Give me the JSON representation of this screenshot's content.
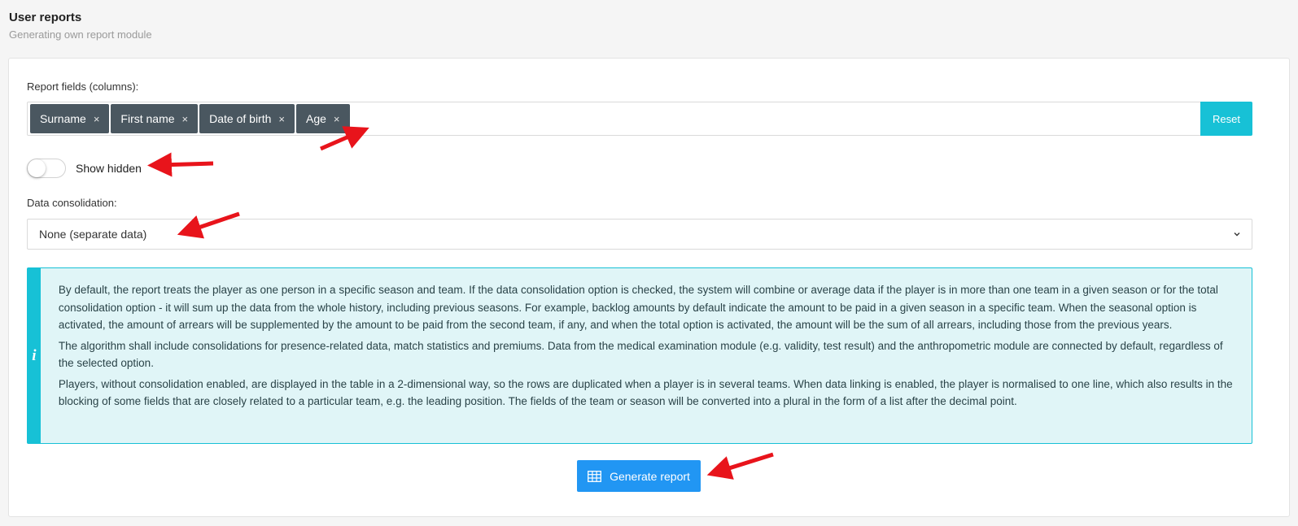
{
  "header": {
    "title": "User reports",
    "subtitle": "Generating own report module"
  },
  "report_fields": {
    "label": "Report fields (columns):",
    "tags": [
      {
        "label": "Surname",
        "remove": "×"
      },
      {
        "label": "First name",
        "remove": "×"
      },
      {
        "label": "Date of birth",
        "remove": "×"
      },
      {
        "label": "Age",
        "remove": "×"
      }
    ],
    "reset_label": "Reset"
  },
  "show_hidden": {
    "label": "Show hidden",
    "checked": false
  },
  "consolidation": {
    "label": "Data consolidation:",
    "selected": "None (separate data)"
  },
  "info": {
    "icon_glyph": "i",
    "paragraphs": [
      "By default, the report treats the player as one person in a specific season and team. If the data consolidation option is checked, the system will combine or average data if the player is in more than one team in a given season or for the total consolidation option - it will sum up the data from the whole history, including previous seasons. For example, backlog amounts by default indicate the amount to be paid in a given season in a specific team. When the seasonal option is activated, the amount of arrears will be supplemented by the amount to be paid from the second team, if any, and when the total option is activated, the amount will be the sum of all arrears, including those from the previous years.",
      "The algorithm shall include consolidations for presence-related data, match statistics and premiums. Data from the medical examination module (e.g. validity, test result) and the anthropometric module are connected by default, regardless of the selected option.",
      "Players, without consolidation enabled, are displayed in the table in a 2-dimensional way, so the rows are duplicated when a player is in several teams. When data linking is enabled, the player is normalised to one line, which also results in the blocking of some fields that are closely related to a particular team, e.g. the leading position. The fields of the team or season will be converted into a plural in the form of a list after the decimal point."
    ]
  },
  "generate_button": {
    "label": "Generate report",
    "icon": "table-icon"
  },
  "colors": {
    "accent_cyan": "#17c1d6",
    "primary_blue": "#2196f3",
    "tag_bg": "#4a5760",
    "annotation_red": "#e8141b"
  }
}
